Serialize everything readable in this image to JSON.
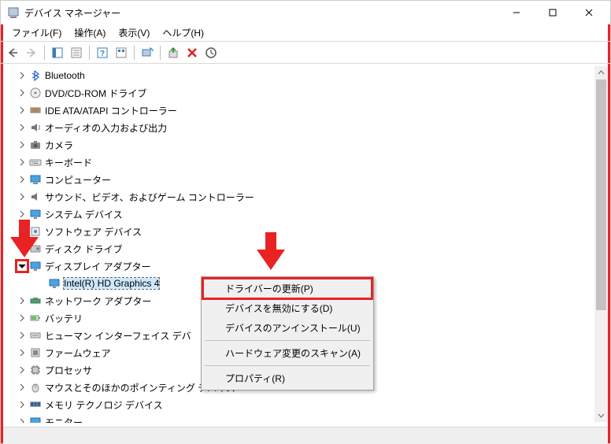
{
  "window": {
    "title": "デバイス マネージャー"
  },
  "menu": {
    "file": "ファイル(F)",
    "action": "操作(A)",
    "view": "表示(V)",
    "help": "ヘルプ(H)"
  },
  "tree": {
    "bluetooth": "Bluetooth",
    "dvd": "DVD/CD-ROM ドライブ",
    "ide": "IDE ATA/ATAPI コントローラー",
    "audio": "オーディオの入力および出力",
    "camera": "カメラ",
    "keyboard": "キーボード",
    "computer": "コンピューター",
    "sound": "サウンド、ビデオ、およびゲーム コントローラー",
    "system": "システム デバイス",
    "software": "ソフトウェア デバイス",
    "disk": "ディスク ドライブ",
    "display": "ディスプレイ アダプター",
    "display_child": "Intel(R) HD Graphics 4",
    "network": "ネットワーク アダプター",
    "battery": "バッテリ",
    "hid": "ヒューマン インターフェイス デバ",
    "firmware": "ファームウェア",
    "processor": "プロセッサ",
    "mouse": "マウスとそのほかのポインティング デバイス",
    "memory": "メモリ テクノロジ デバイス",
    "monitor": "モニター"
  },
  "context_menu": {
    "update": "ドライバーの更新(P)",
    "disable": "デバイスを無効にする(D)",
    "uninstall": "デバイスのアンインストール(U)",
    "scan": "ハードウェア変更のスキャン(A)",
    "properties": "プロパティ(R)"
  }
}
